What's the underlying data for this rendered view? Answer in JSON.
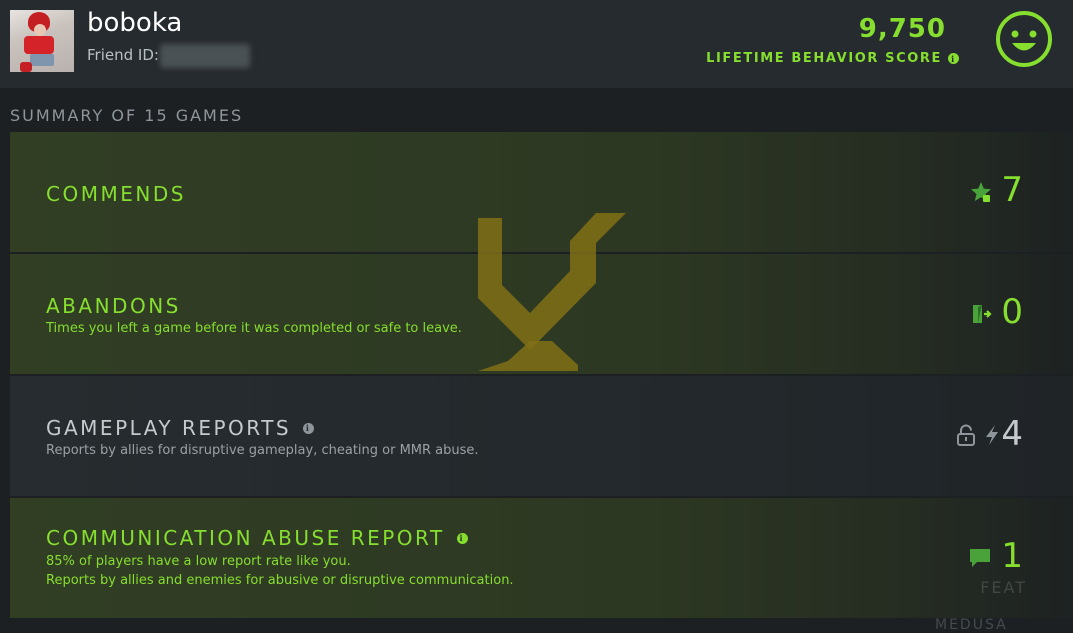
{
  "profile": {
    "username": "boboka",
    "friend_id_label": "Friend ID:"
  },
  "behavior": {
    "score": "9,750",
    "label": "LIFETIME BEHAVIOR SCORE"
  },
  "summary": {
    "title": "SUMMARY OF 15 GAMES",
    "rows": [
      {
        "title": "COMMENDS",
        "description": "",
        "value": "7",
        "icons": [
          "star-thumb-icon"
        ]
      },
      {
        "title": "ABANDONS",
        "description": "Times you left a game before it was completed or safe to leave.",
        "value": "0",
        "icons": [
          "exit-door-icon"
        ]
      },
      {
        "title": "GAMEPLAY REPORTS",
        "description": "Reports by allies for disruptive gameplay, cheating or MMR abuse.",
        "value": "4",
        "icons": [
          "lock-icon",
          "lightning-icon"
        ]
      },
      {
        "title": "COMMUNICATION ABUSE REPORT",
        "description_lines": [
          "85% of players have a low report rate like you.",
          "Reports by allies and enemies for abusive or disruptive communication."
        ],
        "value": "1",
        "icons": [
          "chat-bubble-icon"
        ]
      }
    ]
  },
  "background": {
    "partial_text_1": "FEAT",
    "partial_text_2": "MEDUSA"
  },
  "colors": {
    "accent_green": "#86de2f",
    "emblem_gold": "#a08a18"
  }
}
